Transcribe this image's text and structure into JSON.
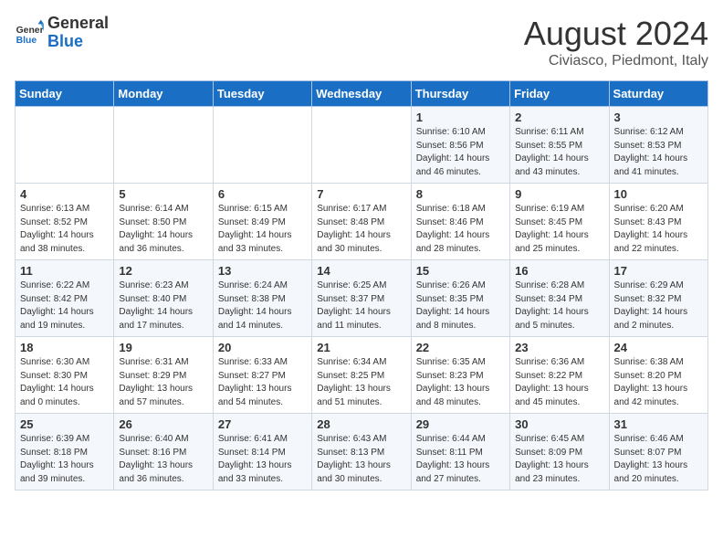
{
  "header": {
    "logo_line1": "General",
    "logo_line2": "Blue",
    "month_year": "August 2024",
    "location": "Civiasco, Piedmont, Italy"
  },
  "days_of_week": [
    "Sunday",
    "Monday",
    "Tuesday",
    "Wednesday",
    "Thursday",
    "Friday",
    "Saturday"
  ],
  "weeks": [
    [
      {
        "day": "",
        "info": ""
      },
      {
        "day": "",
        "info": ""
      },
      {
        "day": "",
        "info": ""
      },
      {
        "day": "",
        "info": ""
      },
      {
        "day": "1",
        "info": "Sunrise: 6:10 AM\nSunset: 8:56 PM\nDaylight: 14 hours\nand 46 minutes."
      },
      {
        "day": "2",
        "info": "Sunrise: 6:11 AM\nSunset: 8:55 PM\nDaylight: 14 hours\nand 43 minutes."
      },
      {
        "day": "3",
        "info": "Sunrise: 6:12 AM\nSunset: 8:53 PM\nDaylight: 14 hours\nand 41 minutes."
      }
    ],
    [
      {
        "day": "4",
        "info": "Sunrise: 6:13 AM\nSunset: 8:52 PM\nDaylight: 14 hours\nand 38 minutes."
      },
      {
        "day": "5",
        "info": "Sunrise: 6:14 AM\nSunset: 8:50 PM\nDaylight: 14 hours\nand 36 minutes."
      },
      {
        "day": "6",
        "info": "Sunrise: 6:15 AM\nSunset: 8:49 PM\nDaylight: 14 hours\nand 33 minutes."
      },
      {
        "day": "7",
        "info": "Sunrise: 6:17 AM\nSunset: 8:48 PM\nDaylight: 14 hours\nand 30 minutes."
      },
      {
        "day": "8",
        "info": "Sunrise: 6:18 AM\nSunset: 8:46 PM\nDaylight: 14 hours\nand 28 minutes."
      },
      {
        "day": "9",
        "info": "Sunrise: 6:19 AM\nSunset: 8:45 PM\nDaylight: 14 hours\nand 25 minutes."
      },
      {
        "day": "10",
        "info": "Sunrise: 6:20 AM\nSunset: 8:43 PM\nDaylight: 14 hours\nand 22 minutes."
      }
    ],
    [
      {
        "day": "11",
        "info": "Sunrise: 6:22 AM\nSunset: 8:42 PM\nDaylight: 14 hours\nand 19 minutes."
      },
      {
        "day": "12",
        "info": "Sunrise: 6:23 AM\nSunset: 8:40 PM\nDaylight: 14 hours\nand 17 minutes."
      },
      {
        "day": "13",
        "info": "Sunrise: 6:24 AM\nSunset: 8:38 PM\nDaylight: 14 hours\nand 14 minutes."
      },
      {
        "day": "14",
        "info": "Sunrise: 6:25 AM\nSunset: 8:37 PM\nDaylight: 14 hours\nand 11 minutes."
      },
      {
        "day": "15",
        "info": "Sunrise: 6:26 AM\nSunset: 8:35 PM\nDaylight: 14 hours\nand 8 minutes."
      },
      {
        "day": "16",
        "info": "Sunrise: 6:28 AM\nSunset: 8:34 PM\nDaylight: 14 hours\nand 5 minutes."
      },
      {
        "day": "17",
        "info": "Sunrise: 6:29 AM\nSunset: 8:32 PM\nDaylight: 14 hours\nand 2 minutes."
      }
    ],
    [
      {
        "day": "18",
        "info": "Sunrise: 6:30 AM\nSunset: 8:30 PM\nDaylight: 14 hours\nand 0 minutes."
      },
      {
        "day": "19",
        "info": "Sunrise: 6:31 AM\nSunset: 8:29 PM\nDaylight: 13 hours\nand 57 minutes."
      },
      {
        "day": "20",
        "info": "Sunrise: 6:33 AM\nSunset: 8:27 PM\nDaylight: 13 hours\nand 54 minutes."
      },
      {
        "day": "21",
        "info": "Sunrise: 6:34 AM\nSunset: 8:25 PM\nDaylight: 13 hours\nand 51 minutes."
      },
      {
        "day": "22",
        "info": "Sunrise: 6:35 AM\nSunset: 8:23 PM\nDaylight: 13 hours\nand 48 minutes."
      },
      {
        "day": "23",
        "info": "Sunrise: 6:36 AM\nSunset: 8:22 PM\nDaylight: 13 hours\nand 45 minutes."
      },
      {
        "day": "24",
        "info": "Sunrise: 6:38 AM\nSunset: 8:20 PM\nDaylight: 13 hours\nand 42 minutes."
      }
    ],
    [
      {
        "day": "25",
        "info": "Sunrise: 6:39 AM\nSunset: 8:18 PM\nDaylight: 13 hours\nand 39 minutes."
      },
      {
        "day": "26",
        "info": "Sunrise: 6:40 AM\nSunset: 8:16 PM\nDaylight: 13 hours\nand 36 minutes."
      },
      {
        "day": "27",
        "info": "Sunrise: 6:41 AM\nSunset: 8:14 PM\nDaylight: 13 hours\nand 33 minutes."
      },
      {
        "day": "28",
        "info": "Sunrise: 6:43 AM\nSunset: 8:13 PM\nDaylight: 13 hours\nand 30 minutes."
      },
      {
        "day": "29",
        "info": "Sunrise: 6:44 AM\nSunset: 8:11 PM\nDaylight: 13 hours\nand 27 minutes."
      },
      {
        "day": "30",
        "info": "Sunrise: 6:45 AM\nSunset: 8:09 PM\nDaylight: 13 hours\nand 23 minutes."
      },
      {
        "day": "31",
        "info": "Sunrise: 6:46 AM\nSunset: 8:07 PM\nDaylight: 13 hours\nand 20 minutes."
      }
    ]
  ]
}
